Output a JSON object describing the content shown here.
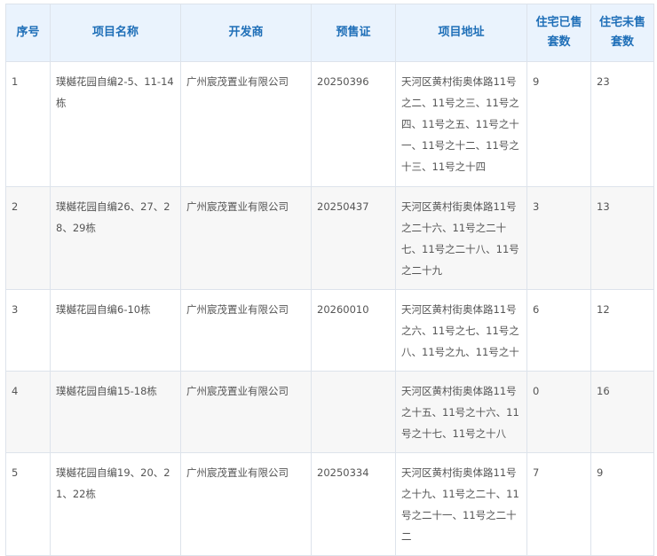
{
  "table": {
    "headers": [
      "序号",
      "项目名称",
      "开发商",
      "预售证",
      "项目地址",
      "住宅已售套数",
      "住宅未售套数"
    ],
    "rows": [
      {
        "no": "1",
        "name": "璞樾花园自编2-5、11-14栋",
        "developer": "广州宸茂置业有限公司",
        "permit": "20250396",
        "address": "天河区黄村街奥体路11号之二、11号之三、11号之四、11号之五、11号之十一、11号之十二、11号之十三、11号之十四",
        "sold": "9",
        "unsold": "23"
      },
      {
        "no": "2",
        "name": "璞樾花园自编26、27、28、29栋",
        "developer": "广州宸茂置业有限公司",
        "permit": "20250437",
        "address": "天河区黄村街奥体路11号之二十六、11号之二十七、11号之二十八、11号之二十九",
        "sold": "3",
        "unsold": "13"
      },
      {
        "no": "3",
        "name": "璞樾花园自编6-10栋",
        "developer": "广州宸茂置业有限公司",
        "permit": "20260010",
        "address": "天河区黄村街奥体路11号之六、11号之七、11号之八、11号之九、11号之十",
        "sold": "6",
        "unsold": "12"
      },
      {
        "no": "4",
        "name": "璞樾花园自编15-18栋",
        "developer": "广州宸茂置业有限公司",
        "permit": "",
        "address": "天河区黄村街奥体路11号之十五、11号之十六、11号之十七、11号之十八",
        "sold": "0",
        "unsold": "16"
      },
      {
        "no": "5",
        "name": "璞樾花园自编19、20、21、22栋",
        "developer": "广州宸茂置业有限公司",
        "permit": "20250334",
        "address": "天河区黄村街奥体路11号之十九、11号之二十、11号之二十一、11号之二十二",
        "sold": "7",
        "unsold": "9"
      }
    ]
  }
}
